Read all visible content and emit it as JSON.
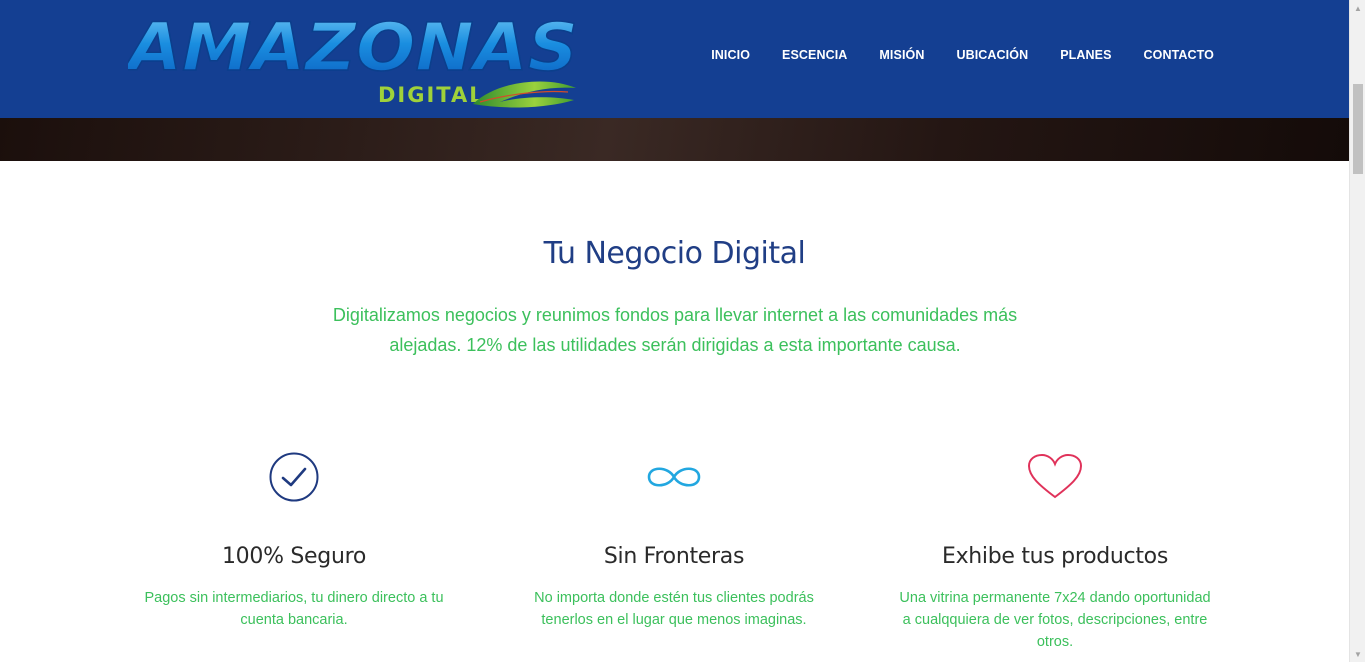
{
  "brand": {
    "logo_main": "AMAZONAS",
    "logo_sub": "DIGITAL"
  },
  "nav": {
    "items": [
      "INICIO",
      "ESCENCIA",
      "MISIÓN",
      "UBICACIÓN",
      "PLANES",
      "CONTACTO"
    ]
  },
  "section": {
    "title": "Tu Negocio Digital",
    "intro": "Digitalizamos negocios y reunimos fondos para llevar internet a las comunidades más alejadas. 12% de las utilidades serán dirigidas a esta importante causa."
  },
  "features": [
    {
      "icon": "check-circle-icon",
      "title": "100% Seguro",
      "text": "Pagos sin intermediarios, tu dinero directo a tu cuenta bancaria."
    },
    {
      "icon": "infinity-icon",
      "title": "Sin Fronteras",
      "text": "No importa donde estén tus clientes podrás tenerlos en el lugar que menos imaginas."
    },
    {
      "icon": "heart-icon",
      "title": "Exhibe tus productos",
      "text": "Una vitrina permanente 7x24 dando oportunidad a cualqquiera de ver fotos, descripciones, entre otros."
    }
  ],
  "colors": {
    "header_bg": "#143f92",
    "title": "#203e85",
    "accent_green": "#3cc05c",
    "check_icon": "#1f3a80",
    "infinity_icon": "#22a7e0",
    "heart_icon": "#e0325a"
  }
}
